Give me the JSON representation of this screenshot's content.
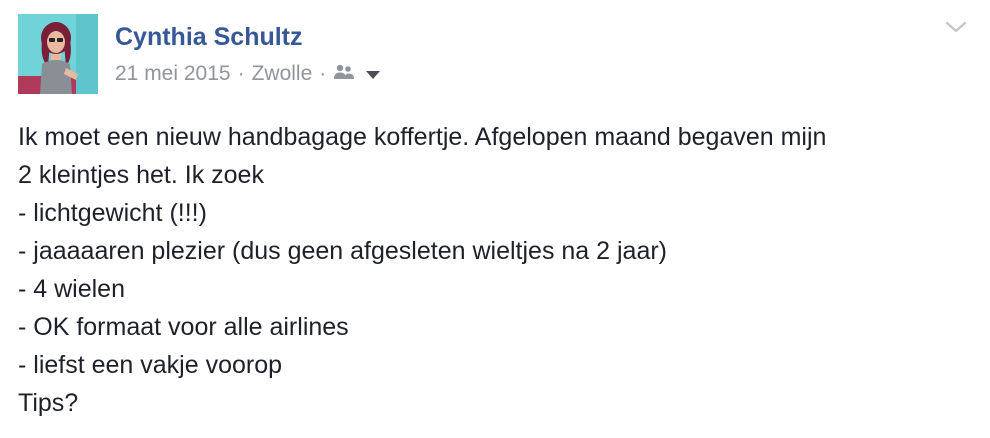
{
  "author": {
    "name": "Cynthia Schultz",
    "avatar_icon": "profile-photo"
  },
  "meta": {
    "date": "21 mei 2015",
    "separator": "·",
    "location": "Zwolle",
    "audience_icon": "friends-icon",
    "audience_dropdown_icon": "caret-down-icon"
  },
  "options_icon": "chevron-down-icon",
  "post": {
    "lines": [
      "Ik moet een nieuw handbagage koffertje. Afgelopen maand begaven mijn",
      "2 kleintjes het. Ik zoek",
      "- lichtgewicht (!!!)",
      "- jaaaaaren plezier (dus geen afgesleten wieltjes na 2 jaar)",
      "- 4 wielen",
      "- OK formaat voor alle airlines",
      "- liefst een vakje voorop",
      "Tips?"
    ]
  },
  "colors": {
    "name": "#365899",
    "meta": "#90949c",
    "text": "#1d2129",
    "avatar_bg": "#6fd3d8"
  }
}
